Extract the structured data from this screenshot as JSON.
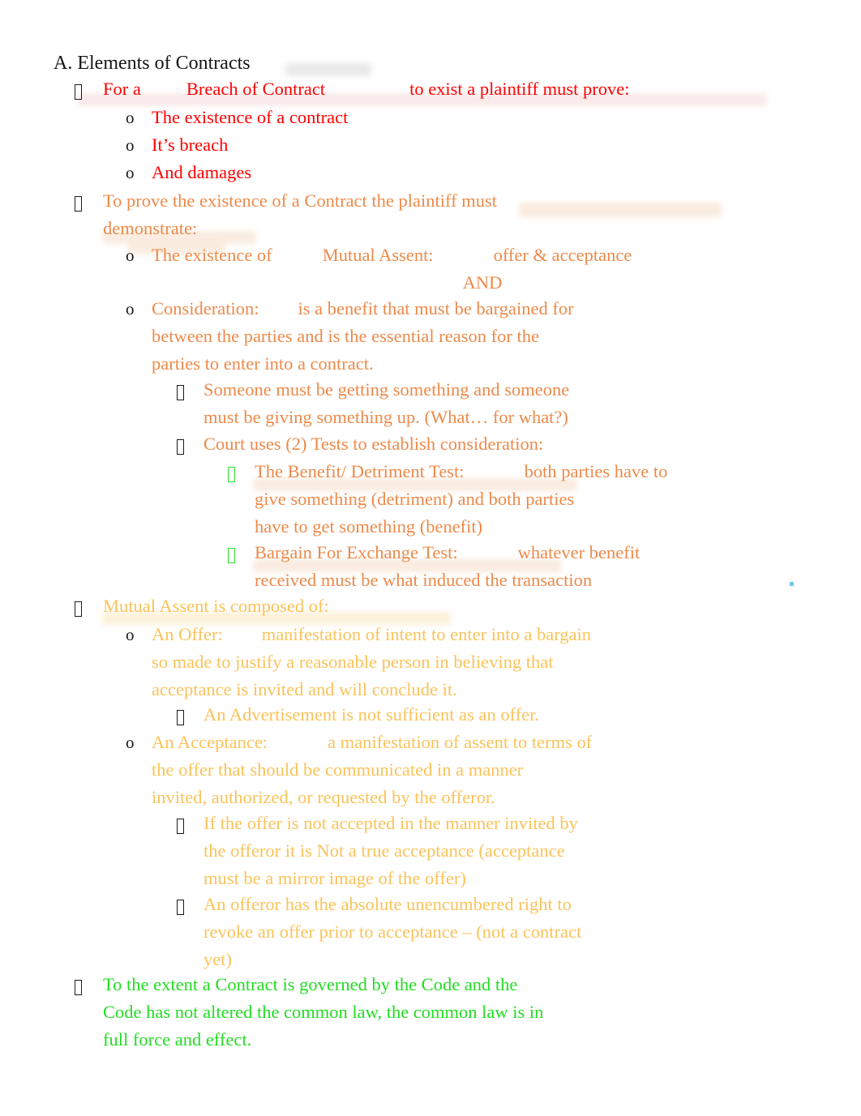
{
  "document": {
    "heading": "A. Elements of Contracts",
    "colors": {
      "heading": "#161616",
      "level_red": "#FF0000",
      "level_orange": "#ED8A4A",
      "level_gold": "#FAC35A",
      "level_green": "#22DD22",
      "bullet_black": "#1A1A1A",
      "bullet_green": "#2EE02E",
      "artifact_dot": "#6FC8F0"
    }
  },
  "outline": {
    "breach": {
      "lead_a": "For a",
      "lead_b": "Breach of Contract",
      "lead_c": "to exist a plaintiff must prove:",
      "items": [
        "The existence of a contract",
        "It’s breach",
        "And damages"
      ]
    },
    "prove_existence": {
      "lead_line1": "To prove the existence of a Contract the plaintiff must",
      "lead_line2": "demonstrate:",
      "mutual_assent": {
        "part_a": "The existence of",
        "part_b": "Mutual Assent:",
        "part_c": "offer & acceptance"
      },
      "and_connector": "AND",
      "consideration": {
        "label": "Consideration:",
        "line1": "is a benefit that must be bargained for",
        "line2": "between the parties and is the essential reason for the",
        "line3": "parties to enter into a contract."
      },
      "consideration_subs": [
        {
          "line1": "Someone must be getting something and someone",
          "line2": "must be giving something up. (What… for what?)"
        },
        {
          "line1": "Court uses (2) Tests to establish consideration:",
          "line2": ""
        }
      ],
      "tests": [
        {
          "label": "The Benefit/ Detriment Test:",
          "line1": "both parties have to",
          "line2": "give something (detriment) and both parties",
          "line3": "have to get something (benefit)"
        },
        {
          "label": "Bargain For Exchange Test:",
          "line1": "whatever benefit",
          "line2": "received must be what induced the transaction",
          "line3": ""
        }
      ]
    },
    "mutual_assent_section": {
      "lead": "Mutual Assent is composed of:",
      "offer": {
        "label": "An Offer:",
        "line1": "manifestation of intent to enter into a bargain",
        "line2": "so made to justify a reasonable person in believing that",
        "line3": "acceptance is invited and will conclude it.",
        "sub": "An Advertisement is not sufficient as an offer."
      },
      "acceptance": {
        "label": "An Acceptance:",
        "line1": "a manifestation of assent to terms of",
        "line2": "the offer that should be communicated in a manner",
        "line3": "invited, authorized, or requested by the offeror.",
        "subs": [
          {
            "line1": "If the offer is not accepted in the manner invited by",
            "line2": "the offeror it is Not a true acceptance (acceptance",
            "line3": "must be a mirror image of the offer)"
          },
          {
            "line1": "An offeror has the absolute unencumbered right to",
            "line2": "revoke an offer prior to acceptance – (not a contract",
            "line3": "yet)"
          }
        ]
      }
    },
    "code_governance": {
      "line1": "To the extent a Contract is governed by the Code and the",
      "line2": "Code has not altered the common law, the common law is in",
      "line3": "full force and effect."
    }
  }
}
